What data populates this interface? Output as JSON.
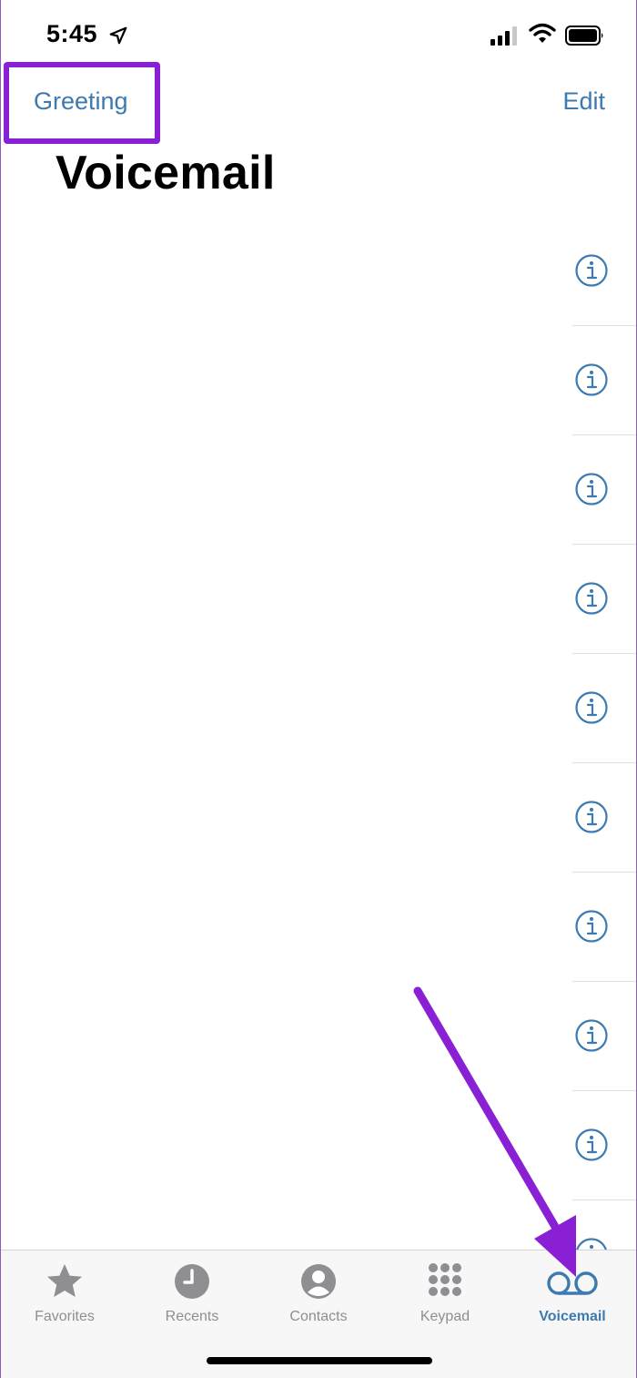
{
  "status_bar": {
    "time": "5:45"
  },
  "nav": {
    "greeting_label": "Greeting",
    "edit_label": "Edit"
  },
  "page": {
    "title": "Voicemail"
  },
  "voicemails": {
    "rows": [
      {
        "icon": "info-circle-icon"
      },
      {
        "icon": "info-circle-icon"
      },
      {
        "icon": "info-circle-icon"
      },
      {
        "icon": "info-circle-icon"
      },
      {
        "icon": "info-circle-icon"
      },
      {
        "icon": "info-circle-icon"
      },
      {
        "icon": "info-circle-icon"
      },
      {
        "icon": "info-circle-icon"
      },
      {
        "icon": "info-circle-icon"
      },
      {
        "icon": "info-circle-icon"
      }
    ]
  },
  "tab_bar": {
    "tabs": [
      {
        "label": "Favorites",
        "icon": "star-icon",
        "active": false
      },
      {
        "label": "Recents",
        "icon": "clock-icon",
        "active": false
      },
      {
        "label": "Contacts",
        "icon": "person-circle-icon",
        "active": false
      },
      {
        "label": "Keypad",
        "icon": "keypad-icon",
        "active": false
      },
      {
        "label": "Voicemail",
        "icon": "voicemail-icon",
        "active": true
      }
    ]
  },
  "colors": {
    "accent": "#3c7ab0",
    "inactive": "#8e8e93",
    "annotation": "#8a20d4"
  }
}
